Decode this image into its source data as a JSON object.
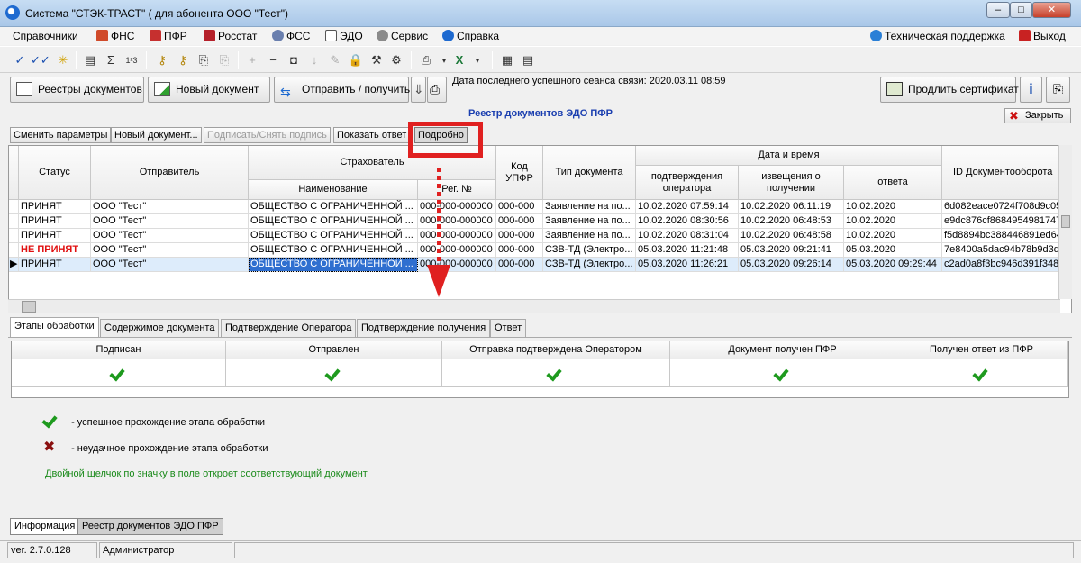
{
  "window": {
    "title": "Система \"СТЭК-ТРАСТ\" ( для абонента ООО \"Тест\")",
    "min": "–",
    "max": "□",
    "close": "✕"
  },
  "menu": [
    {
      "label": "Справочники"
    },
    {
      "label": "ФНС"
    },
    {
      "label": "ПФР"
    },
    {
      "label": "Росстат"
    },
    {
      "label": "ФСС"
    },
    {
      "label": "ЭДО"
    },
    {
      "label": "Сервис"
    },
    {
      "label": "Справка"
    }
  ],
  "menu_right": {
    "support": "Техническая поддержка",
    "exit": "Выход"
  },
  "actions": {
    "registries": "Реестры документов",
    "new_document": "Новый документ",
    "send_receive": "Отправить / получить",
    "last_session": "Дата последнего успешного сеанса связи: 2020.03.11 08:59",
    "extend_cert": "Продлить сертификат"
  },
  "registry": {
    "title": "Реестр документов ЭДО ПФР",
    "close": "Закрыть",
    "buttons": {
      "change_params": "Сменить параметры",
      "new_doc": "Новый документ...",
      "sign": "Подписать/Снять подпись",
      "show_reply": "Показать ответ",
      "details": "Подробно"
    }
  },
  "grid": {
    "headers": {
      "status": "Статус",
      "sender": "Отправитель",
      "insurer": "Страхователь",
      "name": "Наименование",
      "reg": "Рег. №",
      "upfr": "Код УПФР",
      "doctype": "Тип документа",
      "datetime": "Дата и время",
      "op_confirm": "подтверждения оператора",
      "notice": "извещения о получении",
      "reply": "ответа",
      "docflow": "ID Документооборота"
    },
    "rows": [
      {
        "status": "ПРИНЯТ",
        "sender": "ООО \"Тест\"",
        "name": "ОБЩЕСТВО С ОГРАНИЧЕННОЙ ...",
        "reg": "000-000-000000",
        "upfr": "000-000",
        "doctype": "Заявление на по...",
        "op": "10.02.2020 07:59:14",
        "notice": "10.02.2020 06:11:19",
        "reply": "10.02.2020",
        "id": "6d082eace0724f708d9c05"
      },
      {
        "status": "ПРИНЯТ",
        "sender": "ООО \"Тест\"",
        "name": "ОБЩЕСТВО С ОГРАНИЧЕННОЙ ...",
        "reg": "000-000-000000",
        "upfr": "000-000",
        "doctype": "Заявление на по...",
        "op": "10.02.2020 08:30:56",
        "notice": "10.02.2020 06:48:53",
        "reply": "10.02.2020",
        "id": "e9dc876cf8684954981747"
      },
      {
        "status": "ПРИНЯТ",
        "sender": "ООО \"Тест\"",
        "name": "ОБЩЕСТВО С ОГРАНИЧЕННОЙ ...",
        "reg": "000-000-000000",
        "upfr": "000-000",
        "doctype": "Заявление на по...",
        "op": "10.02.2020 08:31:04",
        "notice": "10.02.2020 06:48:58",
        "reply": "10.02.2020",
        "id": "f5d8894bc388446891ed64"
      },
      {
        "status": "НЕ ПРИНЯТ",
        "sender": "ООО \"Тест\"",
        "name": "ОБЩЕСТВО С ОГРАНИЧЕННОЙ ...",
        "reg": "000-000-000000",
        "upfr": "000-000",
        "doctype": "СЗВ-ТД (Электро...",
        "op": "05.03.2020 11:21:48",
        "notice": "05.03.2020 09:21:41",
        "reply": "05.03.2020",
        "id": "7e8400a5dac94b78b9d3d"
      },
      {
        "status": "ПРИНЯТ",
        "sender": "ООО \"Тест\"",
        "name": "ОБЩЕСТВО С ОГРАНИЧЕННОЙ ...",
        "reg": "000-000-000000",
        "upfr": "000-000",
        "doctype": "СЗВ-ТД (Электро...",
        "op": "05.03.2020 11:26:21",
        "notice": "05.03.2020 09:26:14",
        "reply": "05.03.2020 09:29:44",
        "id": "c2ad0a8f3bc946d391f348"
      }
    ]
  },
  "tabs": [
    "Этапы обработки",
    "Содержимое документа",
    "Подтверждение Оператора",
    "Подтверждение получения",
    "Ответ"
  ],
  "stages": [
    "Подписан",
    "Отправлен",
    "Отправка подтверждена Оператором",
    "Документ получен ПФР",
    "Получен ответ из ПФР"
  ],
  "legend": {
    "success": "-  успешное прохождение этапа обработки",
    "fail": "-  неудачное прохождение этапа обработки",
    "hint": "Двойной щелчок по значку в поле откроет соответствующий документ"
  },
  "bottom_tabs": [
    "Информация",
    "Реестр документов ЭДО ПФР"
  ],
  "status": {
    "version": "ver. 2.7.0.128",
    "user": "Администратор"
  }
}
